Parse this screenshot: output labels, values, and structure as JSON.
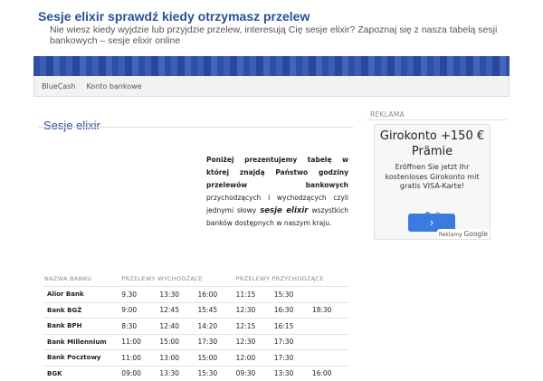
{
  "header": {
    "title": "Sesje elixir sprawdź kiedy otrzymasz przelew",
    "description": "Nie wiesz kiedy wyjdzie lub przyjdzie przelew, interesują Cię sesje elixir? Zapoznaj się z nasza tabelą sesji bankowych – sesje elixir online"
  },
  "nav": {
    "items": [
      "BlueCash",
      "Konto bankowe"
    ]
  },
  "post": {
    "title": "Sesje elixir",
    "intro": {
      "p1": "Poniżej prezentujemy tabelę w której znajdą Państwo godziny przelewów bankowych",
      "p2": " przychodzących i wychodzących czyli jednymi słowy ",
      "em": "sesje elixir",
      "p3": " wszystkich banków dostępnych w naszym kraju."
    }
  },
  "table": {
    "headers": [
      "NAZWA BANKU",
      "PRZELEWY WYCHODZĄCE",
      "PRZELEWY PRZYCHODZĄCE"
    ],
    "rows": [
      [
        "Alior Bank",
        "9.30",
        "13:30",
        "16:00",
        "11:15",
        "15:30",
        ""
      ],
      [
        "Bank BGŻ",
        "9:00",
        "12:45",
        "15:45",
        "12:30",
        "16:30",
        "18:30"
      ],
      [
        "Bank BPH",
        "8:30",
        "12:40",
        "14:20",
        "12:15",
        "16:15",
        ""
      ],
      [
        "Bank Millennium",
        "11:00",
        "15:00",
        "17:30",
        "12:30",
        "17:30",
        ""
      ],
      [
        "Bank Pocztowy",
        "11:00",
        "13:00",
        "15:00",
        "12:00",
        "17:30",
        ""
      ],
      [
        "BGK",
        "09:00",
        "13:30",
        "15:30",
        "09:30",
        "13:30",
        "16:00"
      ]
    ]
  },
  "sidebar": {
    "ad_label": "REKLAMA",
    "ad": {
      "headline": "Girokonto +150 € Prämie",
      "body": "Eröffnen Sie jetzt Ihr kostenloses Girokonto mit gratis VISA-Karte!",
      "button": "›",
      "mark_prefix": "Reklamy",
      "mark_brand": "Google"
    }
  },
  "colors": {
    "link": "#2a4e9b",
    "banner": "#2f4ea6",
    "ad_button": "#3b7bdf"
  }
}
